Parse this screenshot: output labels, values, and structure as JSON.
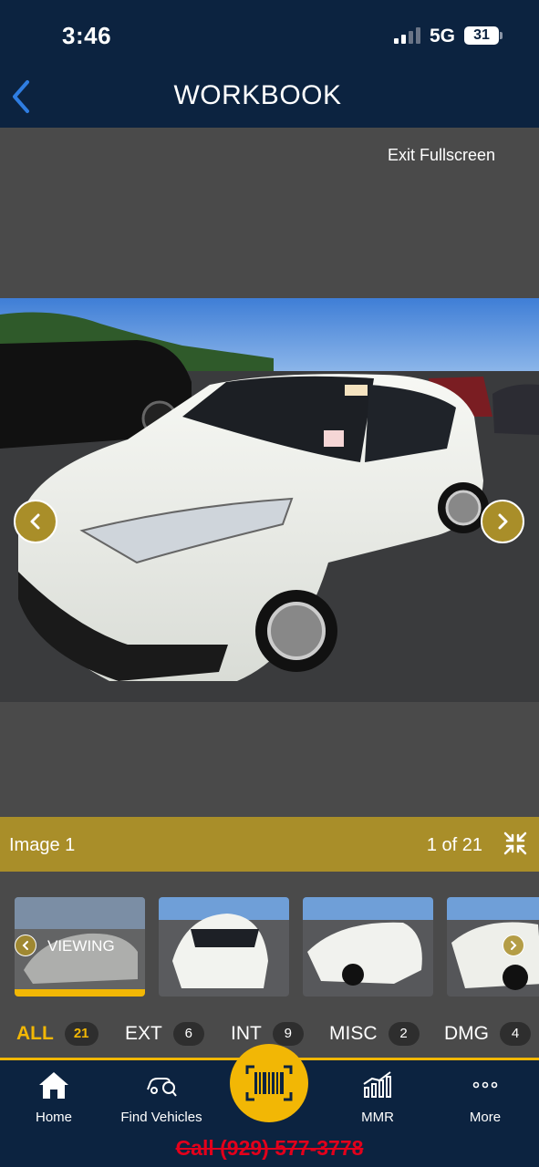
{
  "status_bar": {
    "time": "3:46",
    "network": "5G",
    "battery": "31"
  },
  "nav": {
    "title": "WORKBOOK",
    "back_icon": "chevron-left-icon"
  },
  "viewer": {
    "exit_fullscreen": "Exit Fullscreen"
  },
  "caption": {
    "label": "Image 1",
    "count": "1 of 21",
    "collapse_icon": "collapse-arrows-icon"
  },
  "thumbnails": {
    "viewing_label": "VIEWING"
  },
  "filters": [
    {
      "label": "ALL",
      "count": "21",
      "active": true
    },
    {
      "label": "EXT",
      "count": "6",
      "active": false
    },
    {
      "label": "INT",
      "count": "9",
      "active": false
    },
    {
      "label": "MISC",
      "count": "2",
      "active": false
    },
    {
      "label": "DMG",
      "count": "4",
      "active": false
    }
  ],
  "tabbar": {
    "tabs": [
      {
        "label": "Home",
        "icon": "home-icon"
      },
      {
        "label": "Find Vehicles",
        "icon": "car-search-icon"
      },
      {
        "label": "",
        "icon": "barcode-scan-icon"
      },
      {
        "label": "MMR",
        "icon": "chart-icon"
      },
      {
        "label": "More",
        "icon": "more-dots-icon"
      }
    ]
  },
  "footer": {
    "call_text": "Call (929) 577-3778"
  },
  "colors": {
    "navy": "#0c2340",
    "gold": "#a98e29",
    "accent_yellow": "#f2b705",
    "background": "#4a4a4a",
    "call_red": "#e3001b"
  }
}
